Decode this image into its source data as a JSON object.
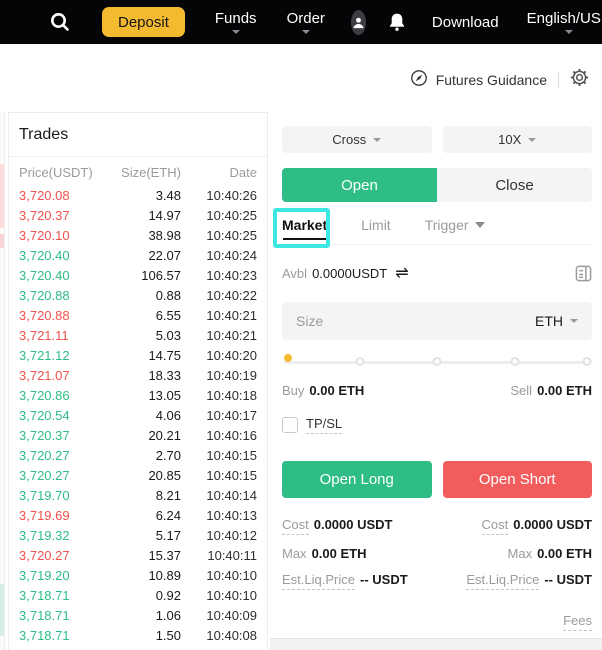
{
  "navbar": {
    "deposit": "Deposit",
    "funds": "Funds",
    "order": "Order",
    "download": "Download",
    "locale": "English/USD"
  },
  "subheader": {
    "guidance": "Futures Guidance"
  },
  "trades": {
    "title": "Trades",
    "columns": [
      "Price(USDT)",
      "Size(ETH)",
      "Date"
    ],
    "rows": [
      {
        "price": "3,720.08",
        "size": "3.48",
        "time": "10:40:26",
        "dir": "down"
      },
      {
        "price": "3,720.37",
        "size": "14.97",
        "time": "10:40:25",
        "dir": "down"
      },
      {
        "price": "3,720.10",
        "size": "38.98",
        "time": "10:40:25",
        "dir": "down"
      },
      {
        "price": "3,720.40",
        "size": "22.07",
        "time": "10:40:24",
        "dir": "up"
      },
      {
        "price": "3,720.40",
        "size": "106.57",
        "time": "10:40:23",
        "dir": "up"
      },
      {
        "price": "3,720.88",
        "size": "0.88",
        "time": "10:40:22",
        "dir": "up"
      },
      {
        "price": "3,720.88",
        "size": "6.55",
        "time": "10:40:21",
        "dir": "down"
      },
      {
        "price": "3,721.11",
        "size": "5.03",
        "time": "10:40:21",
        "dir": "down"
      },
      {
        "price": "3,721.12",
        "size": "14.75",
        "time": "10:40:20",
        "dir": "up"
      },
      {
        "price": "3,721.07",
        "size": "18.33",
        "time": "10:40:19",
        "dir": "down"
      },
      {
        "price": "3,720.86",
        "size": "13.05",
        "time": "10:40:18",
        "dir": "up"
      },
      {
        "price": "3,720.54",
        "size": "4.06",
        "time": "10:40:17",
        "dir": "up"
      },
      {
        "price": "3,720.37",
        "size": "20.21",
        "time": "10:40:16",
        "dir": "up"
      },
      {
        "price": "3,720.27",
        "size": "2.70",
        "time": "10:40:15",
        "dir": "up"
      },
      {
        "price": "3,720.27",
        "size": "20.85",
        "time": "10:40:15",
        "dir": "up"
      },
      {
        "price": "3,719.70",
        "size": "8.21",
        "time": "10:40:14",
        "dir": "up"
      },
      {
        "price": "3,719.69",
        "size": "6.24",
        "time": "10:40:13",
        "dir": "down"
      },
      {
        "price": "3,719.32",
        "size": "5.17",
        "time": "10:40:12",
        "dir": "up"
      },
      {
        "price": "3,720.27",
        "size": "15.37",
        "time": "10:40:11",
        "dir": "down"
      },
      {
        "price": "3,719.20",
        "size": "10.89",
        "time": "10:40:10",
        "dir": "up"
      },
      {
        "price": "3,718.71",
        "size": "0.92",
        "time": "10:40:10",
        "dir": "up"
      },
      {
        "price": "3,718.71",
        "size": "1.06",
        "time": "10:40:09",
        "dir": "up"
      },
      {
        "price": "3,718.71",
        "size": "1.50",
        "time": "10:40:08",
        "dir": "up"
      }
    ]
  },
  "panel": {
    "margin_mode": "Cross",
    "leverage": "10X",
    "side_tabs": {
      "open": "Open",
      "close": "Close"
    },
    "order_type_tabs": {
      "market": "Market",
      "limit": "Limit",
      "trigger": "Trigger"
    },
    "avbl": {
      "label": "Avbl",
      "value": "0.0000USDT"
    },
    "size": {
      "placeholder": "Size",
      "unit": "ETH"
    },
    "buy": {
      "label": "Buy",
      "value": "0.00 ETH"
    },
    "sell": {
      "label": "Sell",
      "value": "0.00 ETH"
    },
    "tpsl_label": "TP/SL",
    "open_long_label": "Open Long",
    "open_short_label": "Open Short",
    "long": {
      "cost_label": "Cost",
      "cost_value": "0.0000 USDT",
      "max_label": "Max",
      "max_value": "0.00 ETH",
      "liq_label": "Est.Liq.Price",
      "liq_value": "-- USDT"
    },
    "short": {
      "cost_label": "Cost",
      "cost_value": "0.0000 USDT",
      "max_label": "Max",
      "max_value": "0.00 ETH",
      "liq_label": "Est.Liq.Price",
      "liq_value": "-- USDT"
    },
    "fees_label": "Fees"
  },
  "colors": {
    "up_green": "#2ebd85",
    "down_red": "#f2514d",
    "accent_yellow": "#f3ba2f",
    "highlight_cyan": "#3be8e2",
    "short_button_red": "#f25c5c"
  }
}
